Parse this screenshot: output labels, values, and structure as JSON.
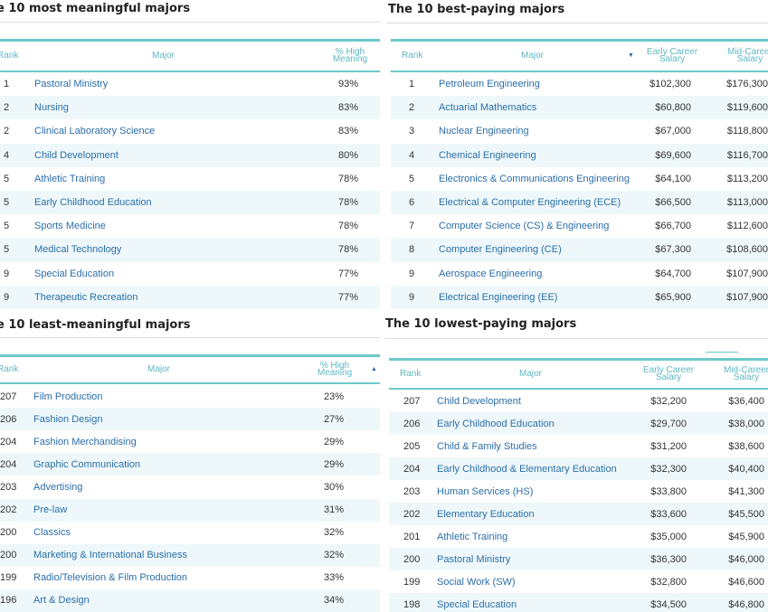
{
  "tables": {
    "meaningful": {
      "title": "e 10 most meaningful majors",
      "headers": {
        "rank": "Rank",
        "major": "Major",
        "pct_1": "% High",
        "pct_2": "Meaning"
      },
      "rows": [
        {
          "rank": "1",
          "major": "Pastoral Ministry",
          "pct": "93%"
        },
        {
          "rank": "2",
          "major": "Nursing",
          "pct": "83%"
        },
        {
          "rank": "2",
          "major": "Clinical Laboratory Science",
          "pct": "83%"
        },
        {
          "rank": "4",
          "major": "Child Development",
          "pct": "80%"
        },
        {
          "rank": "5",
          "major": "Athletic Training",
          "pct": "78%"
        },
        {
          "rank": "5",
          "major": "Early Childhood Education",
          "pct": "78%"
        },
        {
          "rank": "5",
          "major": "Sports Medicine",
          "pct": "78%"
        },
        {
          "rank": "5",
          "major": "Medical Technology",
          "pct": "78%"
        },
        {
          "rank": "9",
          "major": "Special Education",
          "pct": "77%"
        },
        {
          "rank": "9",
          "major": "Therapeutic Recreation",
          "pct": "77%"
        }
      ]
    },
    "best_paying": {
      "title": "The 10 best-paying majors",
      "headers": {
        "rank": "Rank",
        "major": "Major",
        "early_1": "Early Career",
        "early_2": "Salary",
        "mid_1": "Mid-Career",
        "mid_2": "Salary"
      },
      "sort_icon": "sort-down-icon",
      "rows": [
        {
          "rank": "1",
          "major": "Petroleum Engineering",
          "early": "$102,300",
          "mid": "$176,300"
        },
        {
          "rank": "2",
          "major": "Actuarial Mathematics",
          "early": "$60,800",
          "mid": "$119,600"
        },
        {
          "rank": "3",
          "major": "Nuclear Engineering",
          "early": "$67,000",
          "mid": "$118,800"
        },
        {
          "rank": "4",
          "major": "Chemical Engineering",
          "early": "$69,600",
          "mid": "$116,700"
        },
        {
          "rank": "5",
          "major": "Electronics & Communications Engineering",
          "early": "$64,100",
          "mid": "$113,200"
        },
        {
          "rank": "6",
          "major": "Electrical & Computer Engineering (ECE)",
          "early": "$66,500",
          "mid": "$113,000"
        },
        {
          "rank": "7",
          "major": "Computer Science (CS) & Engineering",
          "early": "$66,700",
          "mid": "$112,600"
        },
        {
          "rank": "8",
          "major": "Computer Engineering (CE)",
          "early": "$67,300",
          "mid": "$108,600"
        },
        {
          "rank": "9",
          "major": "Aerospace Engineering",
          "early": "$64,700",
          "mid": "$107,900"
        },
        {
          "rank": "9",
          "major": "Electrical Engineering (EE)",
          "early": "$65,900",
          "mid": "$107,900"
        }
      ]
    },
    "least_meaningful": {
      "title": "e 10 least-meaningful majors",
      "headers": {
        "rank": "Rank",
        "major": "Major",
        "pct_1": "% High",
        "pct_2": "Meaning"
      },
      "sort_icon": "sort-up-icon",
      "rows": [
        {
          "rank": "207",
          "major": "Film Production",
          "pct": "23%"
        },
        {
          "rank": "206",
          "major": "Fashion Design",
          "pct": "27%"
        },
        {
          "rank": "204",
          "major": "Fashion Merchandising",
          "pct": "29%"
        },
        {
          "rank": "204",
          "major": "Graphic Communication",
          "pct": "29%"
        },
        {
          "rank": "203",
          "major": "Advertising",
          "pct": "30%"
        },
        {
          "rank": "202",
          "major": "Pre-law",
          "pct": "31%"
        },
        {
          "rank": "200",
          "major": "Classics",
          "pct": "32%"
        },
        {
          "rank": "200",
          "major": "Marketing & International Business",
          "pct": "32%"
        },
        {
          "rank": "199",
          "major": "Radio/Television & Film Production",
          "pct": "33%"
        },
        {
          "rank": "196",
          "major": "Art & Design",
          "pct": "34%"
        }
      ]
    },
    "lowest_paying": {
      "title": "The 10 lowest-paying majors",
      "headers": {
        "rank": "Rank",
        "major": "Major",
        "early_1": "Early Career",
        "early_2": "Salary",
        "mid_1": "Mid-Career",
        "mid_2": "Salary"
      },
      "rows": [
        {
          "rank": "207",
          "major": "Child Development",
          "early": "$32,200",
          "mid": "$36,400"
        },
        {
          "rank": "206",
          "major": "Early Childhood Education",
          "early": "$29,700",
          "mid": "$38,000"
        },
        {
          "rank": "205",
          "major": "Child & Family Studies",
          "early": "$31,200",
          "mid": "$38,600"
        },
        {
          "rank": "204",
          "major": "Early Childhood & Elementary Education",
          "early": "$32,300",
          "mid": "$40,400"
        },
        {
          "rank": "203",
          "major": "Human Services (HS)",
          "early": "$33,800",
          "mid": "$41,300"
        },
        {
          "rank": "202",
          "major": "Elementary Education",
          "early": "$33,600",
          "mid": "$45,500"
        },
        {
          "rank": "201",
          "major": "Athletic Training",
          "early": "$35,000",
          "mid": "$45,900"
        },
        {
          "rank": "200",
          "major": "Pastoral Ministry",
          "early": "$36,300",
          "mid": "$46,000"
        },
        {
          "rank": "199",
          "major": "Social Work (SW)",
          "early": "$32,800",
          "mid": "$46,600"
        },
        {
          "rank": "198",
          "major": "Special Education",
          "early": "$34,500",
          "mid": "$46,800"
        }
      ]
    }
  }
}
